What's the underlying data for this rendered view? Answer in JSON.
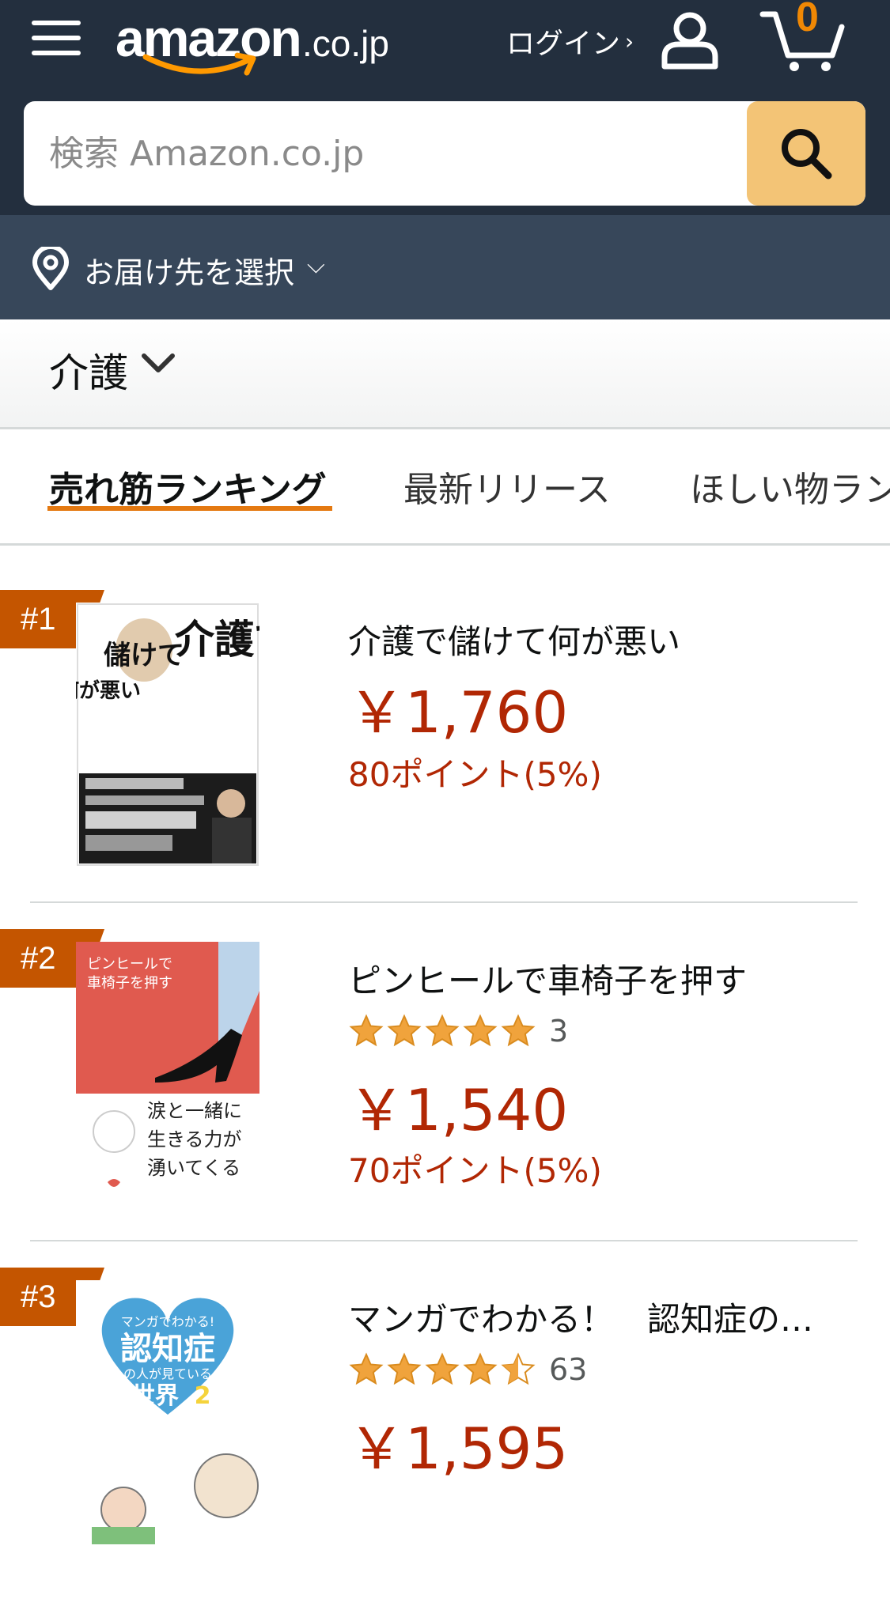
{
  "header": {
    "logo_word": "amazon",
    "logo_tld": ".co.jp",
    "login_label": "ログイン",
    "login_chevron": "›",
    "cart_count": "0",
    "icons": {
      "menu": "hamburger-menu-icon",
      "user": "user-icon",
      "cart": "cart-icon",
      "search": "search-icon",
      "location": "location-pin-icon"
    }
  },
  "search": {
    "placeholder": "検索 Amazon.co.jp",
    "value": ""
  },
  "delivery": {
    "label": "お届け先を選択",
    "chevron": "⌵"
  },
  "category": {
    "title": "介護"
  },
  "tabs": [
    {
      "label": "売れ筋ランキング",
      "active": true
    },
    {
      "label": "最新リリース",
      "active": false
    },
    {
      "label": "ほしい物ランキング",
      "active": false
    }
  ],
  "items": [
    {
      "rank": "#1",
      "title": "介護で儲けて何が悪い",
      "price": "￥1,760",
      "points": "80ポイント(5%)",
      "rating": null,
      "rating_count": null,
      "cover_text": [
        "介護で",
        "儲けて",
        "何が悪い"
      ]
    },
    {
      "rank": "#2",
      "title": "ピンヒールで車椅子を押す",
      "price": "￥1,540",
      "points": "70ポイント(5%)",
      "rating": 5,
      "rating_count": "3",
      "cover_text": [
        "ピンヒールで",
        "車椅子を押す",
        "涙と一緒に",
        "生きる力が",
        "湧いてくる"
      ]
    },
    {
      "rank": "#3",
      "title": "マンガでわかる！　認知症の…",
      "price": "￥1,595",
      "points": "",
      "rating": 4.5,
      "rating_count": "63",
      "cover_text": [
        "マンガでわかる!",
        "認知症",
        "の人が見ている",
        "世界",
        "2"
      ]
    }
  ],
  "colors": {
    "header_bg": "#232f3e",
    "delivery_bg": "#37475a",
    "search_button": "#f3c476",
    "price": "#b12704",
    "rank_badge": "#c45500",
    "tab_underline": "#e47911",
    "star": "#f0a33c",
    "cart_count": "#f08804"
  }
}
